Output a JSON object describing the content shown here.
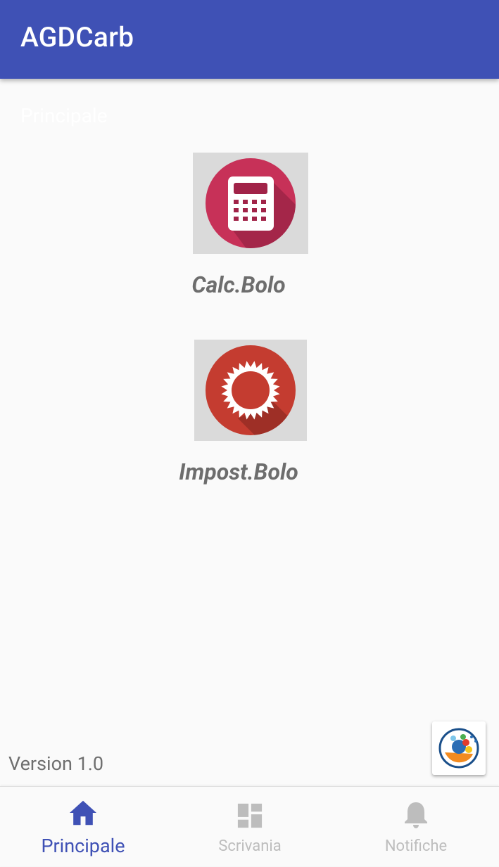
{
  "app_bar": {
    "title": "AGDCarb"
  },
  "main": {
    "fragment_label": "Principale",
    "tiles": [
      {
        "label": "Calc.Bolo",
        "icon": "calculator-icon",
        "color": "#c73158"
      },
      {
        "label": "Impost.Bolo",
        "icon": "gear-icon",
        "color": "#c43c30"
      }
    ],
    "version": "Version 1.0",
    "logo_icon": "diabetes-association-logo"
  },
  "bottom_nav": {
    "items": [
      {
        "label": "Principale",
        "icon": "home-icon",
        "active": true
      },
      {
        "label": "Scrivania",
        "icon": "dashboard-icon",
        "active": false
      },
      {
        "label": "Notifiche",
        "icon": "bell-icon",
        "active": false
      }
    ]
  },
  "colors": {
    "primary": "#3f51b5",
    "inactive": "#bdbdbd",
    "background": "#fafafa"
  }
}
